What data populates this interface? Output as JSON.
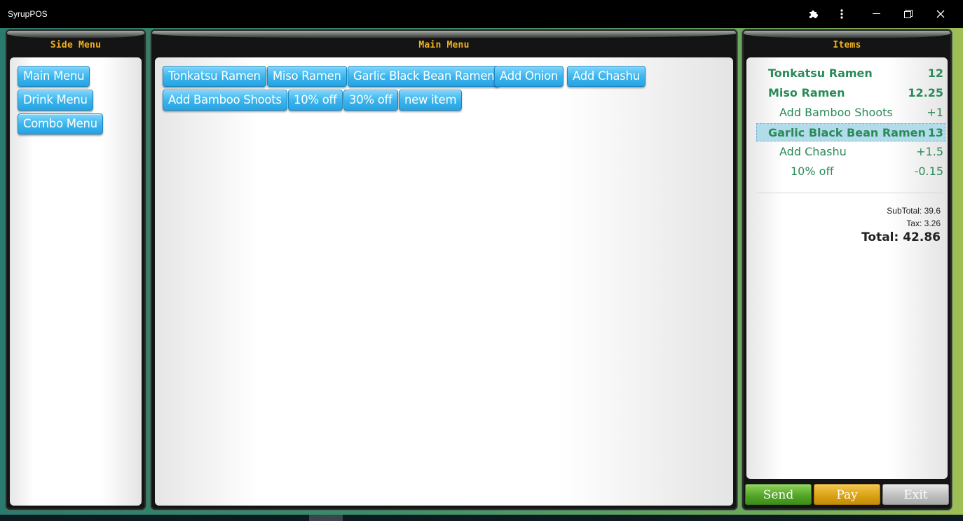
{
  "window": {
    "title": "SyrupPOS",
    "controls": [
      {
        "name": "extensions-icon"
      },
      {
        "name": "more-options-icon"
      },
      {
        "name": "minimize-icon"
      },
      {
        "name": "restore-icon"
      },
      {
        "name": "close-icon"
      }
    ]
  },
  "side_menu": {
    "title": "Side Menu",
    "buttons": [
      "Main Menu",
      "Drink Menu",
      "Combo Menu"
    ]
  },
  "main_menu": {
    "title": "Main Menu",
    "buttons": [
      "Tonkatsu Ramen",
      "Miso Ramen",
      "Garlic Black Bean Ramen",
      "Add Onion",
      "Add Chashu",
      "Add Bamboo Shoots",
      "10% off",
      "30% off",
      "new item"
    ]
  },
  "items": {
    "title": "Items",
    "lines": [
      {
        "name": "Tonkatsu Ramen",
        "price": "12",
        "level": 0,
        "selected": false
      },
      {
        "name": "Miso Ramen",
        "price": "12.25",
        "level": 0,
        "selected": false
      },
      {
        "name": "Add Bamboo Shoots",
        "price": "+1",
        "level": 1,
        "selected": false
      },
      {
        "name": "Garlic Black Bean Ramen",
        "price": "13",
        "level": 0,
        "selected": true
      },
      {
        "name": "Add Chashu",
        "price": "+1.5",
        "level": 1,
        "selected": false
      },
      {
        "name": "10% off",
        "price": "-0.15",
        "level": 2,
        "selected": false
      }
    ],
    "subtotal": "SubTotal: 39.6",
    "tax": "Tax: 3.26",
    "total": "Total: 42.86"
  },
  "actions": {
    "send": "Send",
    "pay": "Pay",
    "exit": "Exit"
  },
  "colors": {
    "panel_title": "#f2b01e",
    "menu_button": "#3db6ee",
    "item_text": "#2a8a58",
    "send": "#4fa325",
    "pay": "#d9a013",
    "exit": "#bdbdbd"
  }
}
